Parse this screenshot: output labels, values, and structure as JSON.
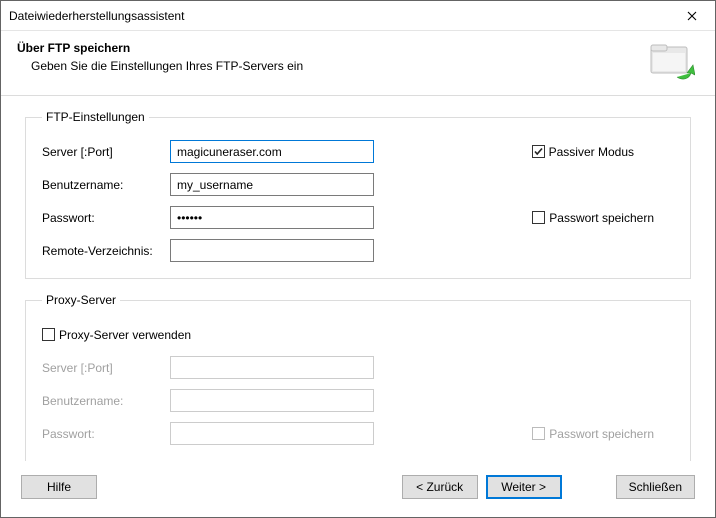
{
  "window": {
    "title": "Dateiwiederherstellungsassistent"
  },
  "header": {
    "title": "Über FTP speichern",
    "subtitle": "Geben Sie die Einstellungen Ihres FTP-Servers ein"
  },
  "ftp": {
    "legend": "FTP-Einstellungen",
    "server_label": "Server [:Port]",
    "server_value": "magicuneraser.com",
    "user_label": "Benutzername:",
    "user_value": "my_username",
    "pass_label": "Passwort:",
    "pass_value": "••••••",
    "remote_label": "Remote-Verzeichnis:",
    "remote_value": "",
    "passive_label": "Passiver Modus",
    "passive_checked": true,
    "save_pass_label": "Passwort speichern",
    "save_pass_checked": false
  },
  "proxy": {
    "legend": "Proxy-Server",
    "use_proxy_label": "Proxy-Server verwenden",
    "use_proxy_checked": false,
    "server_label": "Server [:Port]",
    "server_value": "",
    "user_label": "Benutzername:",
    "user_value": "",
    "pass_label": "Passwort:",
    "pass_value": "",
    "save_pass_label": "Passwort speichern",
    "save_pass_checked": false
  },
  "buttons": {
    "help": "Hilfe",
    "back": "< Zurück",
    "next": "Weiter >",
    "close": "Schließen"
  }
}
